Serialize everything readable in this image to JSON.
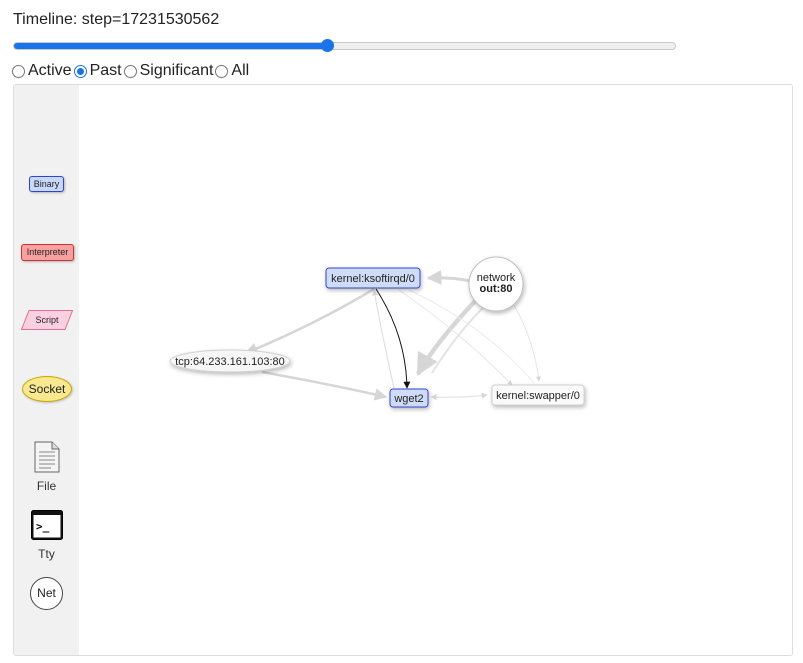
{
  "timeline": {
    "title": "Timeline: step=17231530562",
    "slider_fraction": 0.474
  },
  "view_options": [
    {
      "label": "Active",
      "checked": false
    },
    {
      "label": "Past",
      "checked": true
    },
    {
      "label": "Significant",
      "checked": false
    },
    {
      "label": "All",
      "checked": false
    }
  ],
  "legend": {
    "binary": "Binary",
    "interpreter": "Interpreter",
    "script": "Script",
    "socket": "Socket",
    "file": "File",
    "tty": "Tty",
    "tty_glyph": ">_",
    "net": "Net"
  },
  "graph": {
    "nodes": {
      "ksoftirqd": "kernel:ksoftirqd/0",
      "network_line1": "network",
      "network_line2": "out:80",
      "tcp": "tcp:64.233.161.103:80",
      "wget": "wget2",
      "swapper": "kernel:swapper/0"
    }
  },
  "colors": {
    "accent": "#1a73e8",
    "binary_fill": "#c8d8f8",
    "binary_border": "#3344cc",
    "interpreter_fill": "#f7a0a0",
    "script_fill": "#fbd0e0",
    "socket_fill": "#f8e890",
    "edge": "#d9d9d9"
  }
}
